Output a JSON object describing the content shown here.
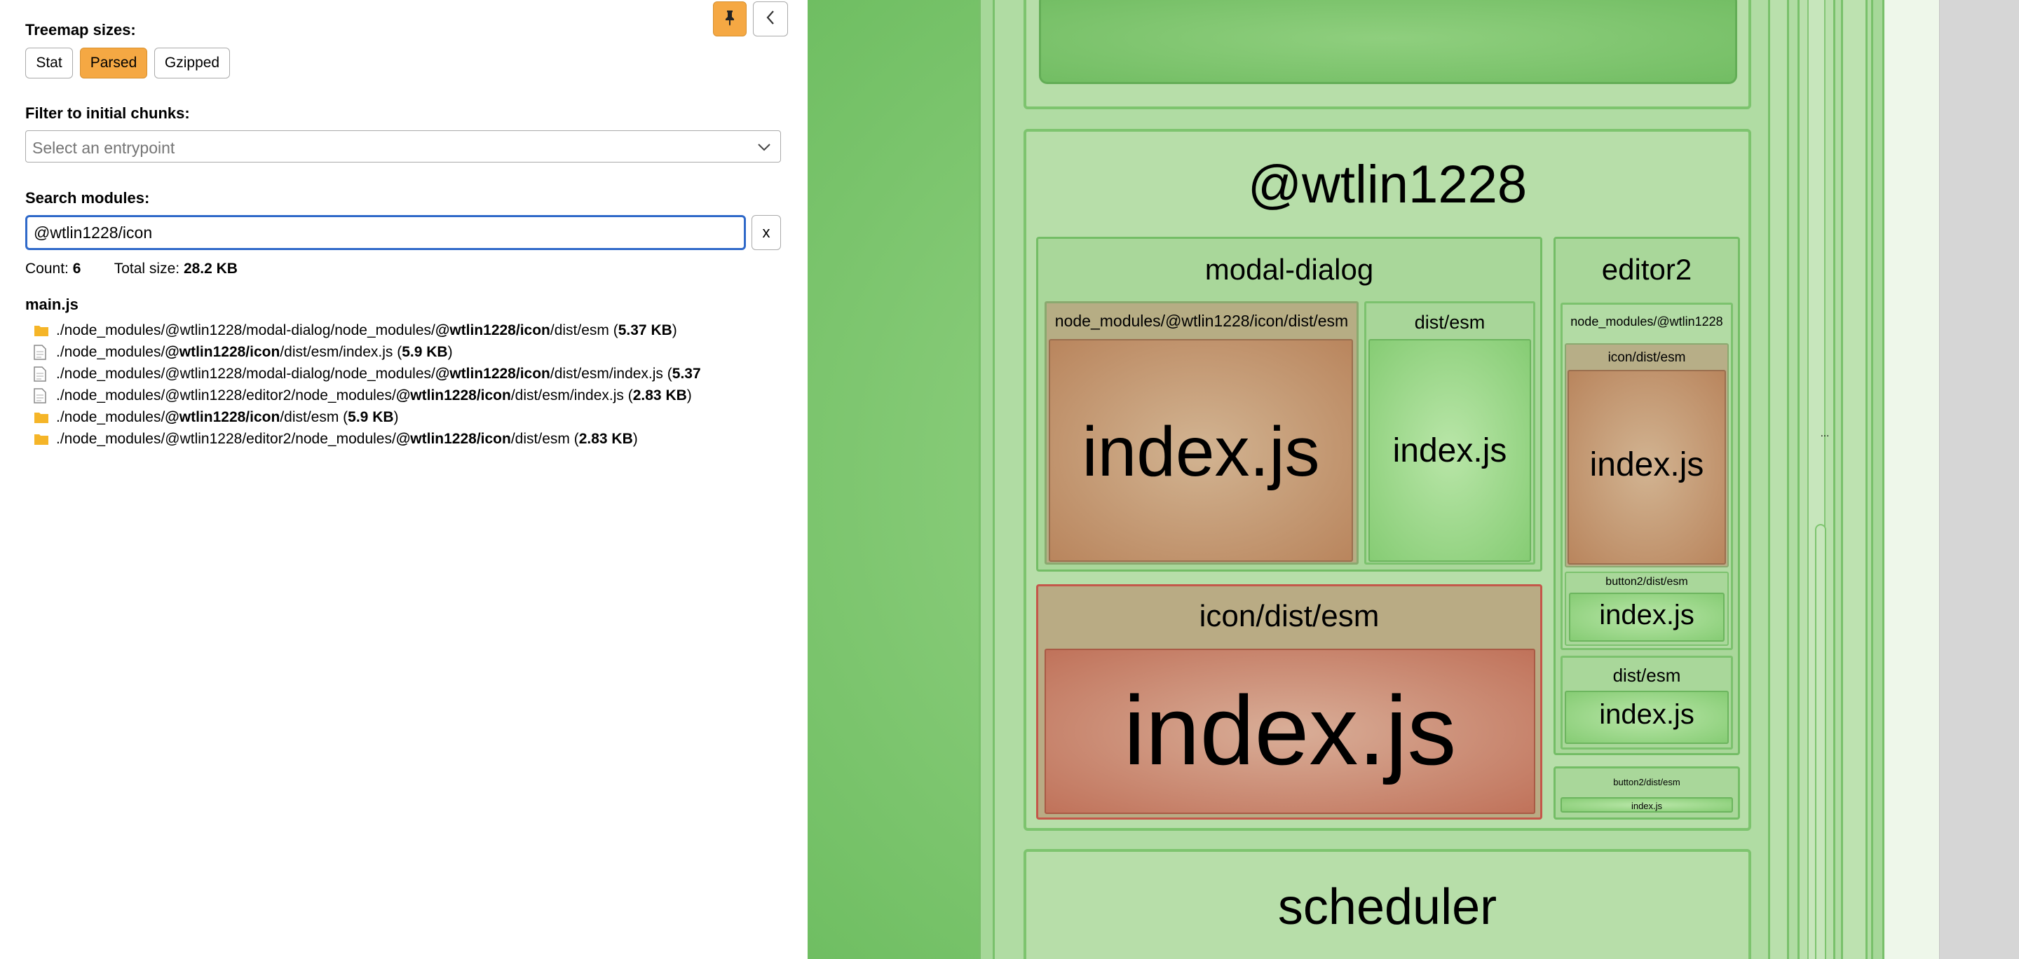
{
  "sidebar": {
    "treemap_sizes_label": "Treemap sizes:",
    "size_buttons": [
      "Stat",
      "Parsed",
      "Gzipped"
    ],
    "active_size": "Parsed",
    "filter_label": "Filter to initial chunks:",
    "entrypoint_placeholder": "Select an entrypoint",
    "search_label": "Search modules:",
    "search_value": "@wtlin1228/icon",
    "clear_label": "x",
    "count_label": "Count:",
    "count_value": "6",
    "total_size_label": "Total size:",
    "total_size_value": "28.2 KB",
    "chunk_name": "main.js",
    "modules": [
      {
        "icon": "folder-icon",
        "prefix": "./node_modules/@wtlin1228/modal-dialog/node_modules/",
        "match": "@wtlin1228/icon",
        "suffix": "/dist/esm (",
        "size": "5.37 KB",
        "close": ")"
      },
      {
        "icon": "file-icon",
        "prefix": "./node_modules/",
        "match": "@wtlin1228/icon",
        "suffix": "/dist/esm/index.js (",
        "size": "5.9 KB",
        "close": ")"
      },
      {
        "icon": "file-icon",
        "prefix": "./node_modules/@wtlin1228/modal-dialog/node_modules/",
        "match": "@wtlin1228/icon",
        "suffix": "/dist/esm/index.js (",
        "size": "5.37",
        "close": ""
      },
      {
        "icon": "file-icon",
        "prefix": "./node_modules/@wtlin1228/editor2/node_modules/",
        "match": "@wtlin1228/icon",
        "suffix": "/dist/esm/index.js (",
        "size": "2.83 KB",
        "close": ")"
      },
      {
        "icon": "folder-icon",
        "prefix": "./node_modules/",
        "match": "@wtlin1228/icon",
        "suffix": "/dist/esm (",
        "size": "5.9 KB",
        "close": ")"
      },
      {
        "icon": "folder-icon",
        "prefix": "./node_modules/@wtlin1228/editor2/node_modules/",
        "match": "@wtlin1228/icon",
        "suffix": "/dist/esm (",
        "size": "2.83 KB",
        "close": ")"
      }
    ]
  },
  "treemap": {
    "wtlin": "@wtlin1228",
    "modal_dialog": "modal-dialog",
    "modal_icon_path": "node_modules/@wtlin1228/icon/dist/esm",
    "modal_icon_file": "index.js",
    "modal_dist": "dist/esm",
    "modal_dist_file": "index.js",
    "icon_dist": "icon/dist/esm",
    "icon_dist_file": "index.js",
    "editor2": "editor2",
    "editor2_nm": "node_modules/@wtlin1228",
    "editor2_icon": "icon/dist/esm",
    "editor2_icon_file": "index.js",
    "editor2_button": "button2/dist/esm",
    "editor2_button_file": "index.js",
    "editor2_dist": "dist/esm",
    "editor2_dist_file": "index.js",
    "button2": "button2/dist/esm",
    "button2_file": "index.js",
    "scheduler": "scheduler",
    "ellipsis": "..."
  }
}
